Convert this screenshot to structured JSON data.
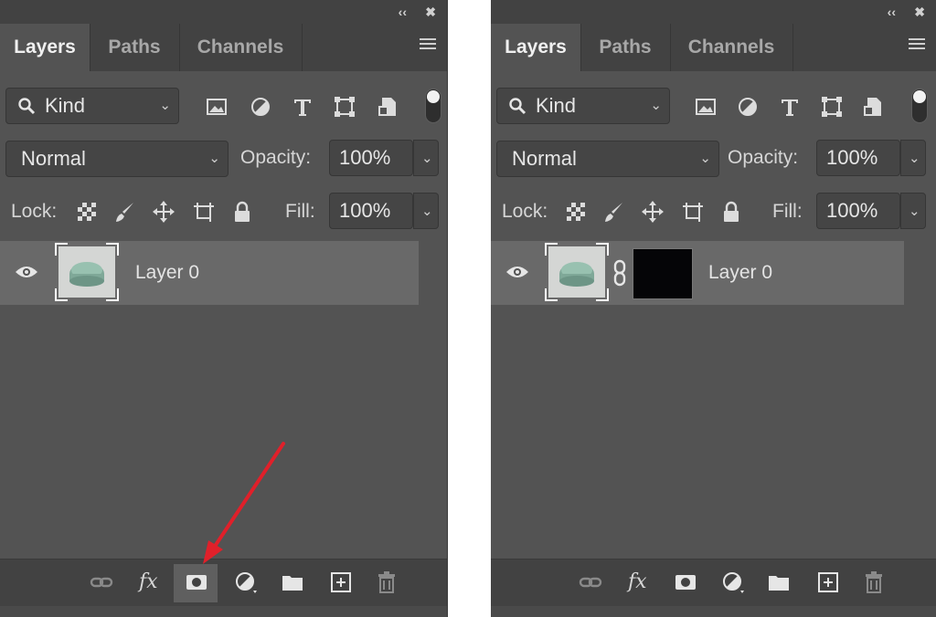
{
  "colors": {
    "panel_bg": "#535353",
    "header_bg": "#424242",
    "selected_row": "#696969",
    "annotation_arrow": "#e0202a"
  },
  "panels": [
    {
      "id": "left",
      "tabs": [
        {
          "label": "Layers",
          "active": true
        },
        {
          "label": "Paths",
          "active": false
        },
        {
          "label": "Channels",
          "active": false
        }
      ],
      "filter": {
        "value": "Kind",
        "icons": [
          "image-filter-icon",
          "adjustment-filter-icon",
          "type-filter-icon",
          "shape-filter-icon",
          "smart-object-filter-icon"
        ]
      },
      "blend_mode": "Normal",
      "opacity": {
        "label": "Opacity:",
        "value": "100%"
      },
      "lock": {
        "label": "Lock:",
        "icons": [
          "lock-transparent-icon",
          "lock-image-icon",
          "lock-position-icon",
          "lock-artboard-icon",
          "lock-all-icon"
        ]
      },
      "fill": {
        "label": "Fill:",
        "value": "100%"
      },
      "layers": [
        {
          "name": "Layer 0",
          "visible": true,
          "has_mask": false
        }
      ],
      "bottom_icons": [
        "link-layers-icon",
        "fx-icon",
        "add-mask-icon",
        "adjustment-layer-icon",
        "new-group-icon",
        "new-layer-icon",
        "delete-layer-icon"
      ],
      "fx_label": "fx"
    },
    {
      "id": "right",
      "tabs": [
        {
          "label": "Layers",
          "active": true
        },
        {
          "label": "Paths",
          "active": false
        },
        {
          "label": "Channels",
          "active": false
        }
      ],
      "filter": {
        "value": "Kind"
      },
      "blend_mode": "Normal",
      "opacity": {
        "label": "Opacity:",
        "value": "100%"
      },
      "lock": {
        "label": "Lock:"
      },
      "fill": {
        "label": "Fill:",
        "value": "100%"
      },
      "layers": [
        {
          "name": "Layer 0",
          "visible": true,
          "has_mask": true
        }
      ],
      "fx_label": "fx"
    }
  ]
}
